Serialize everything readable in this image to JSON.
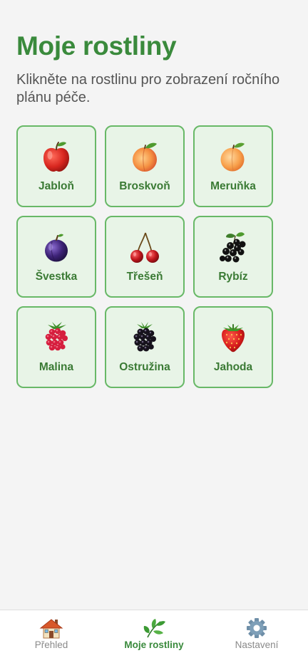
{
  "header": {
    "title": "Moje rostliny",
    "subtitle": "Klikněte na rostlinu pro zobrazení ročního plánu péče."
  },
  "plants": [
    {
      "label": "Jabloň",
      "icon": "apple-icon"
    },
    {
      "label": "Broskvoň",
      "icon": "peach-icon"
    },
    {
      "label": "Meruňka",
      "icon": "apricot-icon"
    },
    {
      "label": "Švestka",
      "icon": "plum-icon"
    },
    {
      "label": "Třešeň",
      "icon": "cherry-icon"
    },
    {
      "label": "Rybíz",
      "icon": "currant-icon"
    },
    {
      "label": "Malina",
      "icon": "raspberry-icon"
    },
    {
      "label": "Ostružina",
      "icon": "blackberry-icon"
    },
    {
      "label": "Jahoda",
      "icon": "strawberry-icon"
    }
  ],
  "bottom_nav": {
    "items": [
      {
        "label": "Přehled",
        "icon": "house-icon",
        "active": false
      },
      {
        "label": "Moje rostliny",
        "icon": "leaf-icon",
        "active": true
      },
      {
        "label": "Nastavení",
        "icon": "gear-icon",
        "active": false
      }
    ]
  },
  "colors": {
    "accent": "#3a8a3c",
    "card_background": "#e8f4e7",
    "card_border": "#68b867",
    "page_background": "#f4f4f4"
  }
}
